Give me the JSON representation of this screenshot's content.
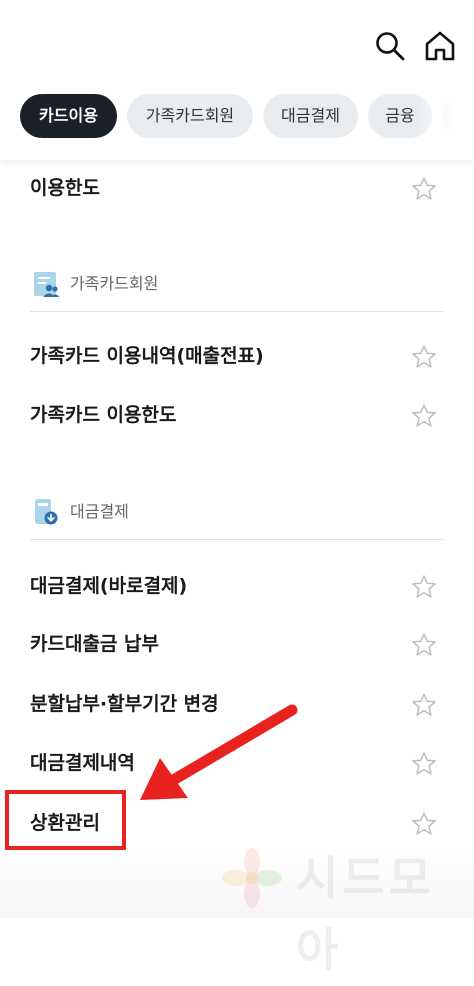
{
  "tabs": [
    {
      "label": "카드이용",
      "active": true
    },
    {
      "label": "가족카드회원",
      "active": false
    },
    {
      "label": "대금결제",
      "active": false
    },
    {
      "label": "금융",
      "active": false
    },
    {
      "label": "카",
      "active": false
    }
  ],
  "icons": {
    "search": "search-icon",
    "home": "home-icon",
    "star": "star-outline-icon"
  },
  "items": {
    "usage_limit": "이용한도",
    "family_usage_detail": "가족카드 이용내역(매출전표)",
    "family_limit": "가족카드 이용한도",
    "pay_now": "대금결제(바로결제)",
    "loan_payment": "카드대출금 납부",
    "installment_change": "분할납부·할부기간 변경",
    "payment_history": "대금결제내역",
    "repayment": "상환관리"
  },
  "sections": {
    "family": "가족카드회원",
    "payment": "대금결제"
  },
  "annotation": {
    "arrow_color": "#e8231f",
    "box_color": "#e8231f"
  },
  "watermark": {
    "text": "시드모아"
  }
}
